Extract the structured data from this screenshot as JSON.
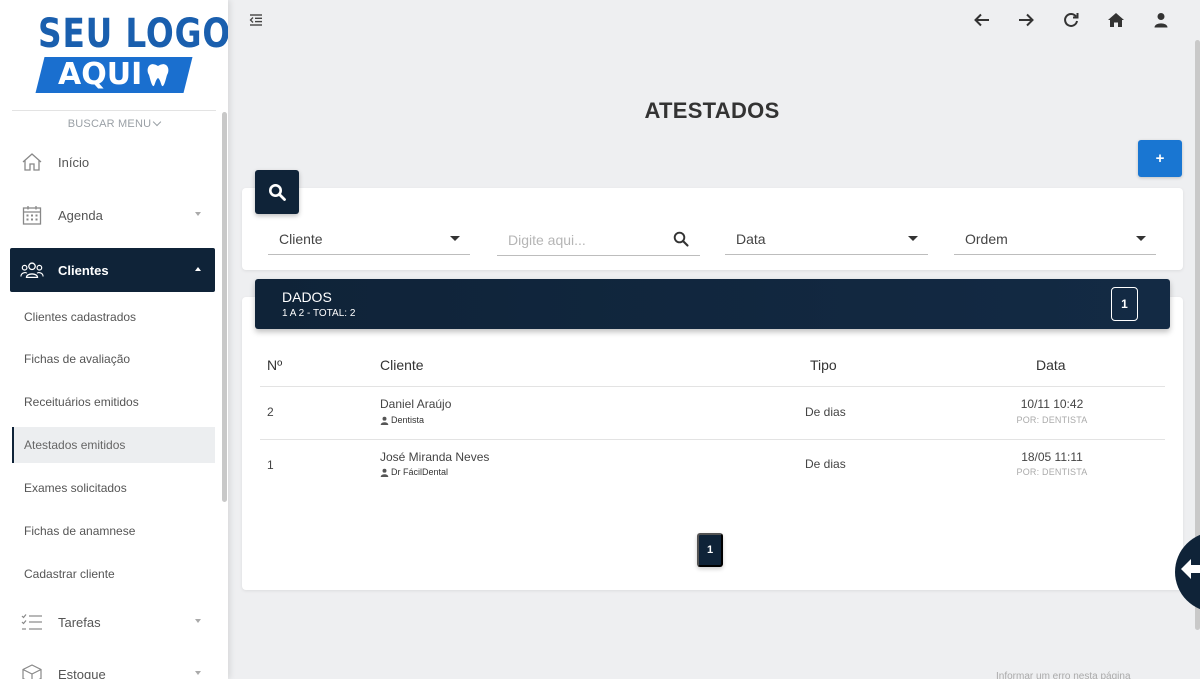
{
  "logo": {
    "line1": "SEU LOGO",
    "line2": "AQUI"
  },
  "sidebar": {
    "search_menu": "BUSCAR MENU",
    "items": [
      {
        "label": "Início",
        "icon": "home-icon"
      },
      {
        "label": "Agenda",
        "icon": "calendar-icon"
      },
      {
        "label": "Clientes",
        "icon": "users-icon"
      },
      {
        "label": "Tarefas",
        "icon": "task-list-icon"
      },
      {
        "label": "Estoque",
        "icon": "box-icon"
      }
    ],
    "subitems": [
      {
        "label": "Clientes cadastrados"
      },
      {
        "label": "Fichas de avaliação"
      },
      {
        "label": "Receituários emitidos"
      },
      {
        "label": "Atestados emitidos"
      },
      {
        "label": "Exames solicitados"
      },
      {
        "label": "Fichas de anamnese"
      },
      {
        "label": "Cadastrar cliente"
      }
    ]
  },
  "topbar": {
    "icons": [
      "menu-collapse-icon",
      "arrow-left-icon",
      "arrow-right-icon",
      "refresh-icon",
      "home-icon",
      "user-icon"
    ]
  },
  "page": {
    "title": "ATESTADOS",
    "add_label": "+"
  },
  "filters": {
    "cliente": "Cliente",
    "search_placeholder": "Digite aqui...",
    "data": "Data",
    "ordem": "Ordem"
  },
  "data_panel": {
    "title": "DADOS",
    "subtitle": "1 A 2 - TOTAL: 2",
    "count": "1"
  },
  "table": {
    "headers": {
      "num": "Nº",
      "cliente": "Cliente",
      "tipo": "Tipo",
      "data": "Data"
    },
    "rows": [
      {
        "num": "2",
        "cliente": "Daniel Araújo",
        "por": "Dentista",
        "tipo": "De dias",
        "data": "10/11 10:42",
        "por_label": "POR: DENTISTA"
      },
      {
        "num": "1",
        "cliente": "José Miranda Neves",
        "por": "Dr FácilDental",
        "tipo": "De dias",
        "data": "18/05 11:11",
        "por_label": "POR: DENTISTA"
      }
    ]
  },
  "pagination": {
    "current": "1"
  },
  "footer": {
    "note": "Informar um erro nesta página"
  },
  "colors": {
    "navy": "#0f2338",
    "primary": "#1976d2",
    "brand_blue": "#1a5fae"
  }
}
